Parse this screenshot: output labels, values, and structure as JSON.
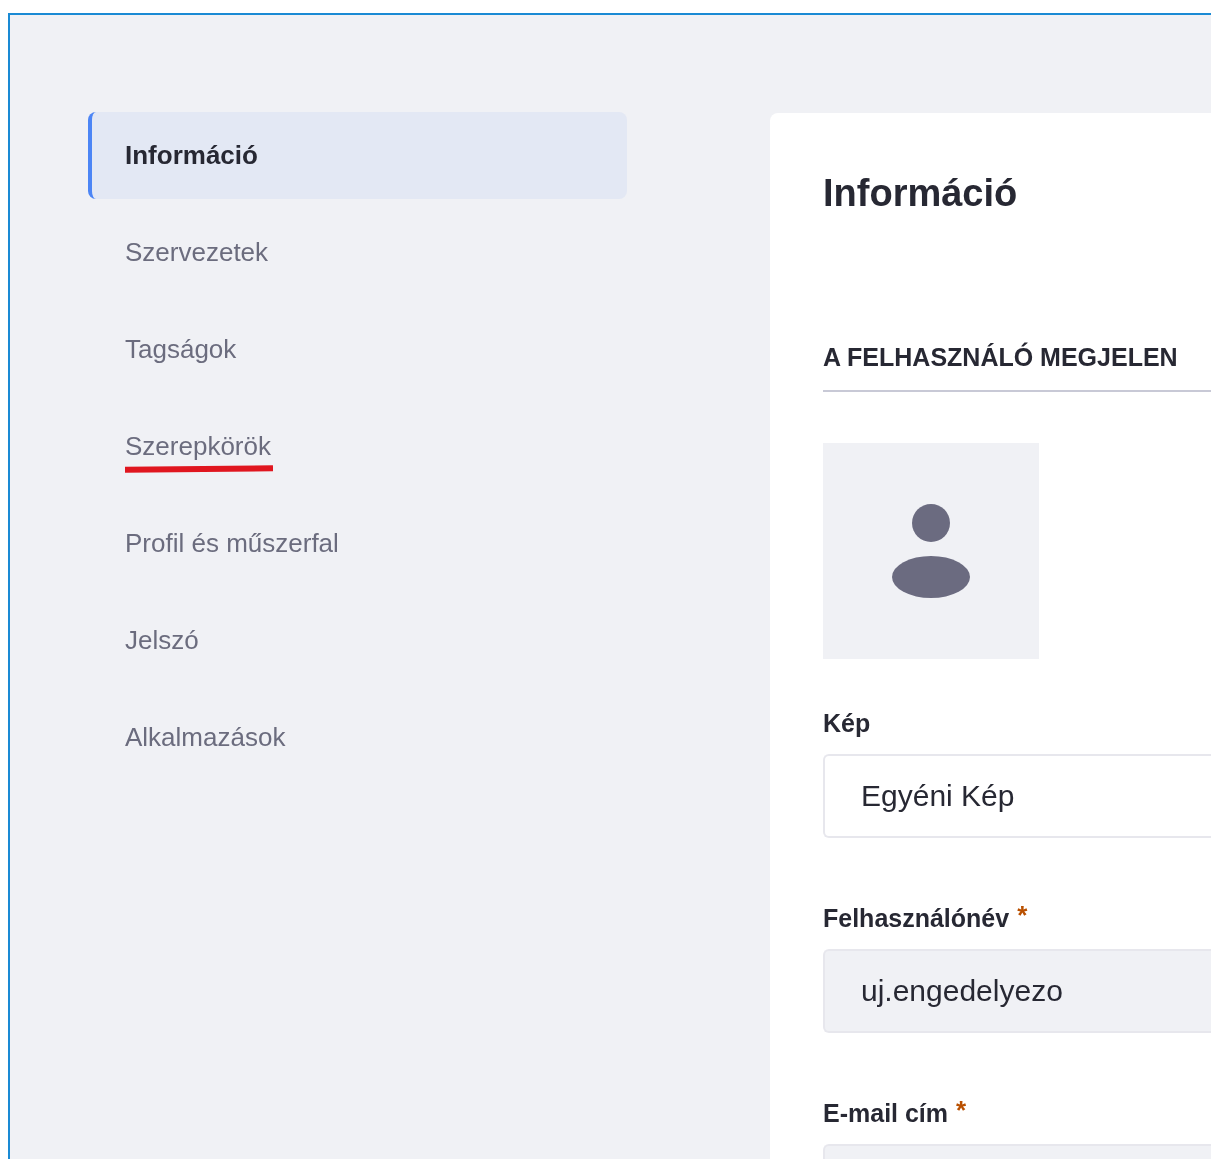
{
  "sidebar": {
    "items": [
      {
        "label": "Információ",
        "selected": true,
        "underlined": false
      },
      {
        "label": "Szervezetek",
        "selected": false,
        "underlined": false
      },
      {
        "label": "Tagságok",
        "selected": false,
        "underlined": false
      },
      {
        "label": "Szerepkörök",
        "selected": false,
        "underlined": true
      },
      {
        "label": "Profil és műszerfal",
        "selected": false,
        "underlined": false
      },
      {
        "label": "Jelszó",
        "selected": false,
        "underlined": false
      },
      {
        "label": "Alkalmazások",
        "selected": false,
        "underlined": false
      }
    ]
  },
  "panel": {
    "title": "Információ",
    "section_title": "A FELHASZNÁLÓ MEGJELEN",
    "fields": [
      {
        "label": "Kép",
        "value": "Egyéni Kép",
        "disabled": false
      },
      {
        "label": "Felhasználónév",
        "required_mark": "*",
        "value": "uj.engedelyezo",
        "disabled": true
      },
      {
        "label": "E-mail cím",
        "required_mark": "*",
        "disabled": true
      }
    ]
  }
}
